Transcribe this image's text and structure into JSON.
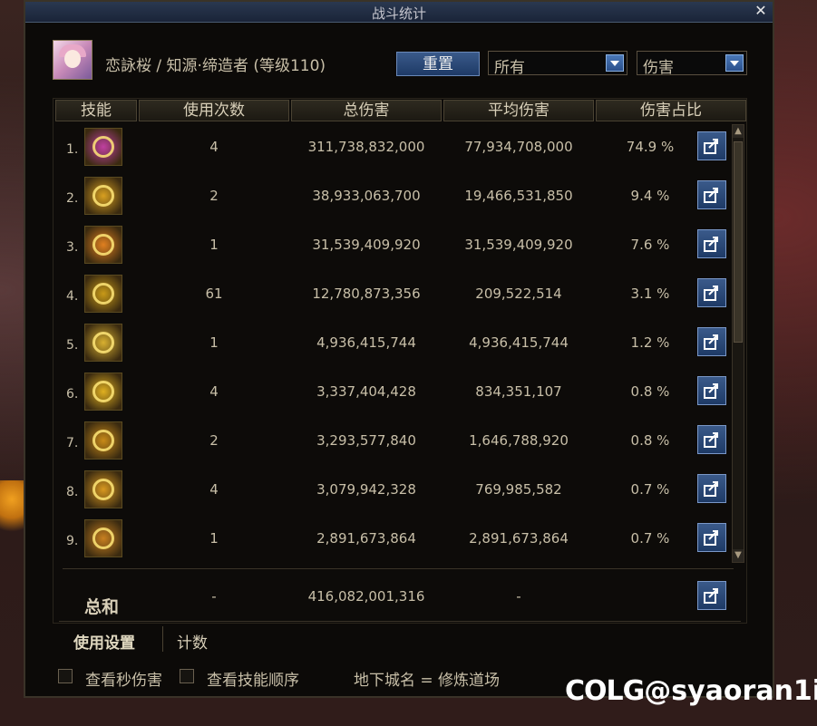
{
  "window": {
    "title": "战斗统计",
    "close_symbol": "✕"
  },
  "character": {
    "name": "恋詠桜 / 知源·缔造者 (等级110)"
  },
  "controls": {
    "reset_label": "重置",
    "filter_select": "所有",
    "type_select": "伤害"
  },
  "table": {
    "headers": [
      "技能",
      "使用次数",
      "总伤害",
      "平均伤害",
      "伤害占比"
    ],
    "rows": [
      {
        "num": "1.",
        "uses": "4",
        "total": "311,738,832,000",
        "avg": "77,934,708,000",
        "pct": "74.9 %",
        "icon_color": "#c040a0"
      },
      {
        "num": "2.",
        "uses": "2",
        "total": "38,933,063,700",
        "avg": "19,466,531,850",
        "pct": "9.4 %",
        "icon_color": "#d8a020"
      },
      {
        "num": "3.",
        "uses": "1",
        "total": "31,539,409,920",
        "avg": "31,539,409,920",
        "pct": "7.6 %",
        "icon_color": "#e08020"
      },
      {
        "num": "4.",
        "uses": "61",
        "total": "12,780,873,356",
        "avg": "209,522,514",
        "pct": "3.1 %",
        "icon_color": "#c89a18"
      },
      {
        "num": "5.",
        "uses": "1",
        "total": "4,936,415,744",
        "avg": "4,936,415,744",
        "pct": "1.2 %",
        "icon_color": "#d8b030"
      },
      {
        "num": "6.",
        "uses": "4",
        "total": "3,337,404,428",
        "avg": "834,351,107",
        "pct": "0.8 %",
        "icon_color": "#e0b020"
      },
      {
        "num": "7.",
        "uses": "2",
        "total": "3,293,577,840",
        "avg": "1,646,788,920",
        "pct": "0.8 %",
        "icon_color": "#c88a18"
      },
      {
        "num": "8.",
        "uses": "4",
        "total": "3,079,942,328",
        "avg": "769,985,582",
        "pct": "0.7 %",
        "icon_color": "#d89820"
      },
      {
        "num": "9.",
        "uses": "1",
        "total": "2,891,673,864",
        "avg": "2,891,673,864",
        "pct": "0.7 %",
        "icon_color": "#c88020"
      }
    ],
    "summary": {
      "label": "总和",
      "uses": "-",
      "total": "416,082,001,316",
      "avg": "-"
    }
  },
  "footer_tabs": {
    "settings": "使用设置",
    "count": "计数"
  },
  "options": {
    "dps_label": "查看秒伤害",
    "order_label": "查看技能顺序",
    "dungeon": "地下城名 = 修炼道场"
  },
  "watermark": {
    "logo": "COLG",
    "handle": "@syaoran1i"
  },
  "colors": {
    "accent_blue": "#2a4f8a",
    "text": "#c8bfa8",
    "panel": "#0c0a08"
  }
}
